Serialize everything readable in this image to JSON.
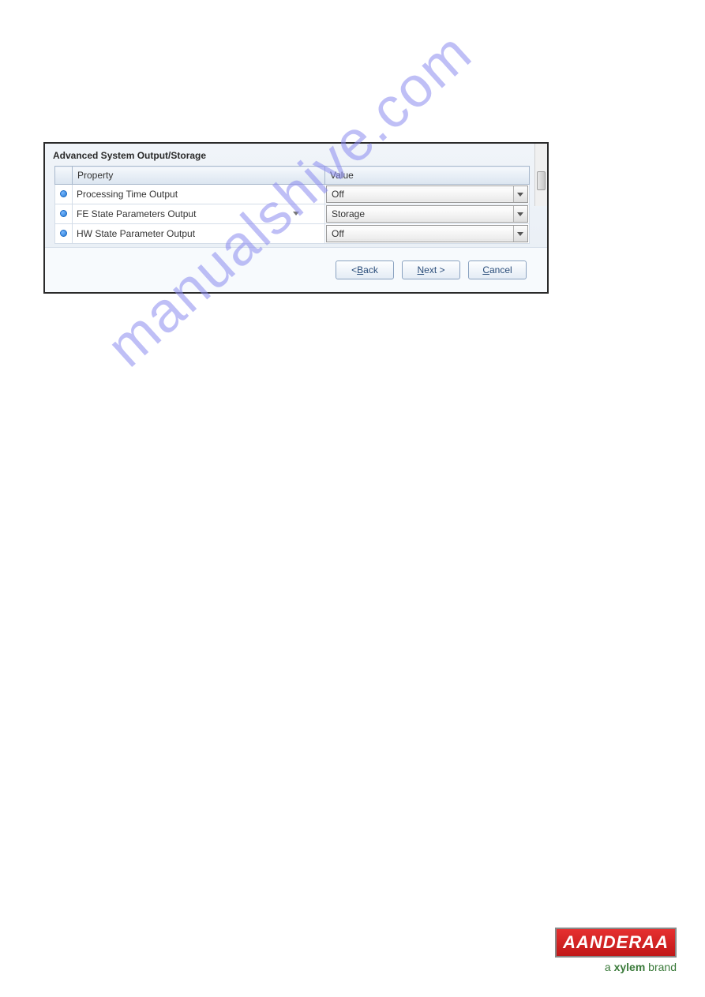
{
  "panel": {
    "title": "Advanced System Output/Storage",
    "headers": {
      "property": "Property",
      "value": "Value"
    },
    "rows": [
      {
        "property": "Processing Time Output",
        "value": "Off"
      },
      {
        "property": "FE State Parameters Output",
        "value": "Storage"
      },
      {
        "property": "HW State Parameter Output",
        "value": "Off"
      }
    ]
  },
  "buttons": {
    "back_prefix": "< ",
    "back_letter": "B",
    "back_rest": "ack",
    "next_letter": "N",
    "next_rest": "ext >",
    "cancel_letter": "C",
    "cancel_rest": "ancel"
  },
  "watermark": "manualshive.com",
  "brand": {
    "logo": "AANDERAA",
    "tagline_prefix": "a ",
    "tagline_bold": "xylem",
    "tagline_suffix": " brand"
  }
}
